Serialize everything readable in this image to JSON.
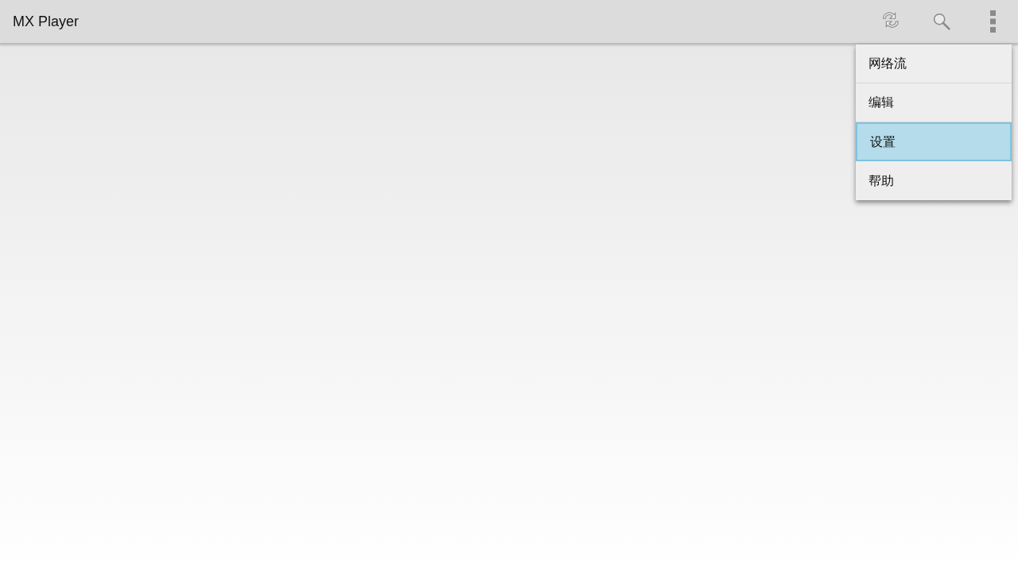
{
  "app_bar": {
    "title": "MX Player",
    "actions": [
      {
        "kind": "refresh"
      },
      {
        "kind": "search"
      },
      {
        "kind": "overflow"
      }
    ]
  },
  "menu": [
    {
      "label": "网络流",
      "selected": false
    },
    {
      "label": "编辑",
      "selected": false
    },
    {
      "label": "设置",
      "selected": true
    },
    {
      "label": "帮助",
      "selected": false
    }
  ]
}
